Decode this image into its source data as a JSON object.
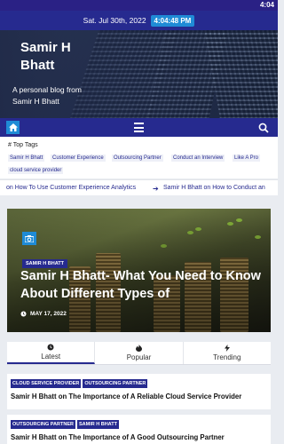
{
  "status_bar": {
    "time": "4:04"
  },
  "date_bar": {
    "date": "Sat. Jul 30th, 2022",
    "time": "4:04:48 PM"
  },
  "header": {
    "title": "Samir H Bhatt",
    "tagline": "A personal blog from Samir H Bhatt"
  },
  "nav": {
    "icons": [
      "home-icon",
      "menu-icon",
      "search-icon"
    ]
  },
  "top_tags": {
    "title": "Top Tags",
    "tags": [
      "Samir H Bhatt",
      "Customer Experience",
      "Outsourcing Partner",
      "Conduct an Interview",
      "Like A Pro",
      "cloud service provider"
    ]
  },
  "ticker": {
    "items": [
      "on How To Use Customer Experience Analytics",
      "Samir H Bhatt on How to Conduct an"
    ]
  },
  "featured": {
    "category": "SAMIR H BHATT",
    "title": "Samir H Bhatt- What You Need to Know About Different Types of",
    "date": "MAY 17, 2022"
  },
  "tabs": [
    {
      "label": "Latest",
      "icon": "clock-icon"
    },
    {
      "label": "Popular",
      "icon": "fire-icon"
    },
    {
      "label": "Trending",
      "icon": "bolt-icon"
    }
  ],
  "posts": [
    {
      "categories": [
        "CLOUD SERVICE PROVIDER",
        "OUTSOURCING PARTNER"
      ],
      "title": "Samir H Bhatt on The Importance of A Reliable Cloud Service Provider"
    },
    {
      "categories": [
        "OUTSOURCING PARTNER",
        "SAMIR H BHATT"
      ],
      "title": "Samir H Bhatt on The Importance of A Good Outsourcing Partner"
    }
  ],
  "colors": {
    "primary": "#262a8f",
    "accent": "#1f8bd6",
    "background": "#e9ecf1"
  }
}
